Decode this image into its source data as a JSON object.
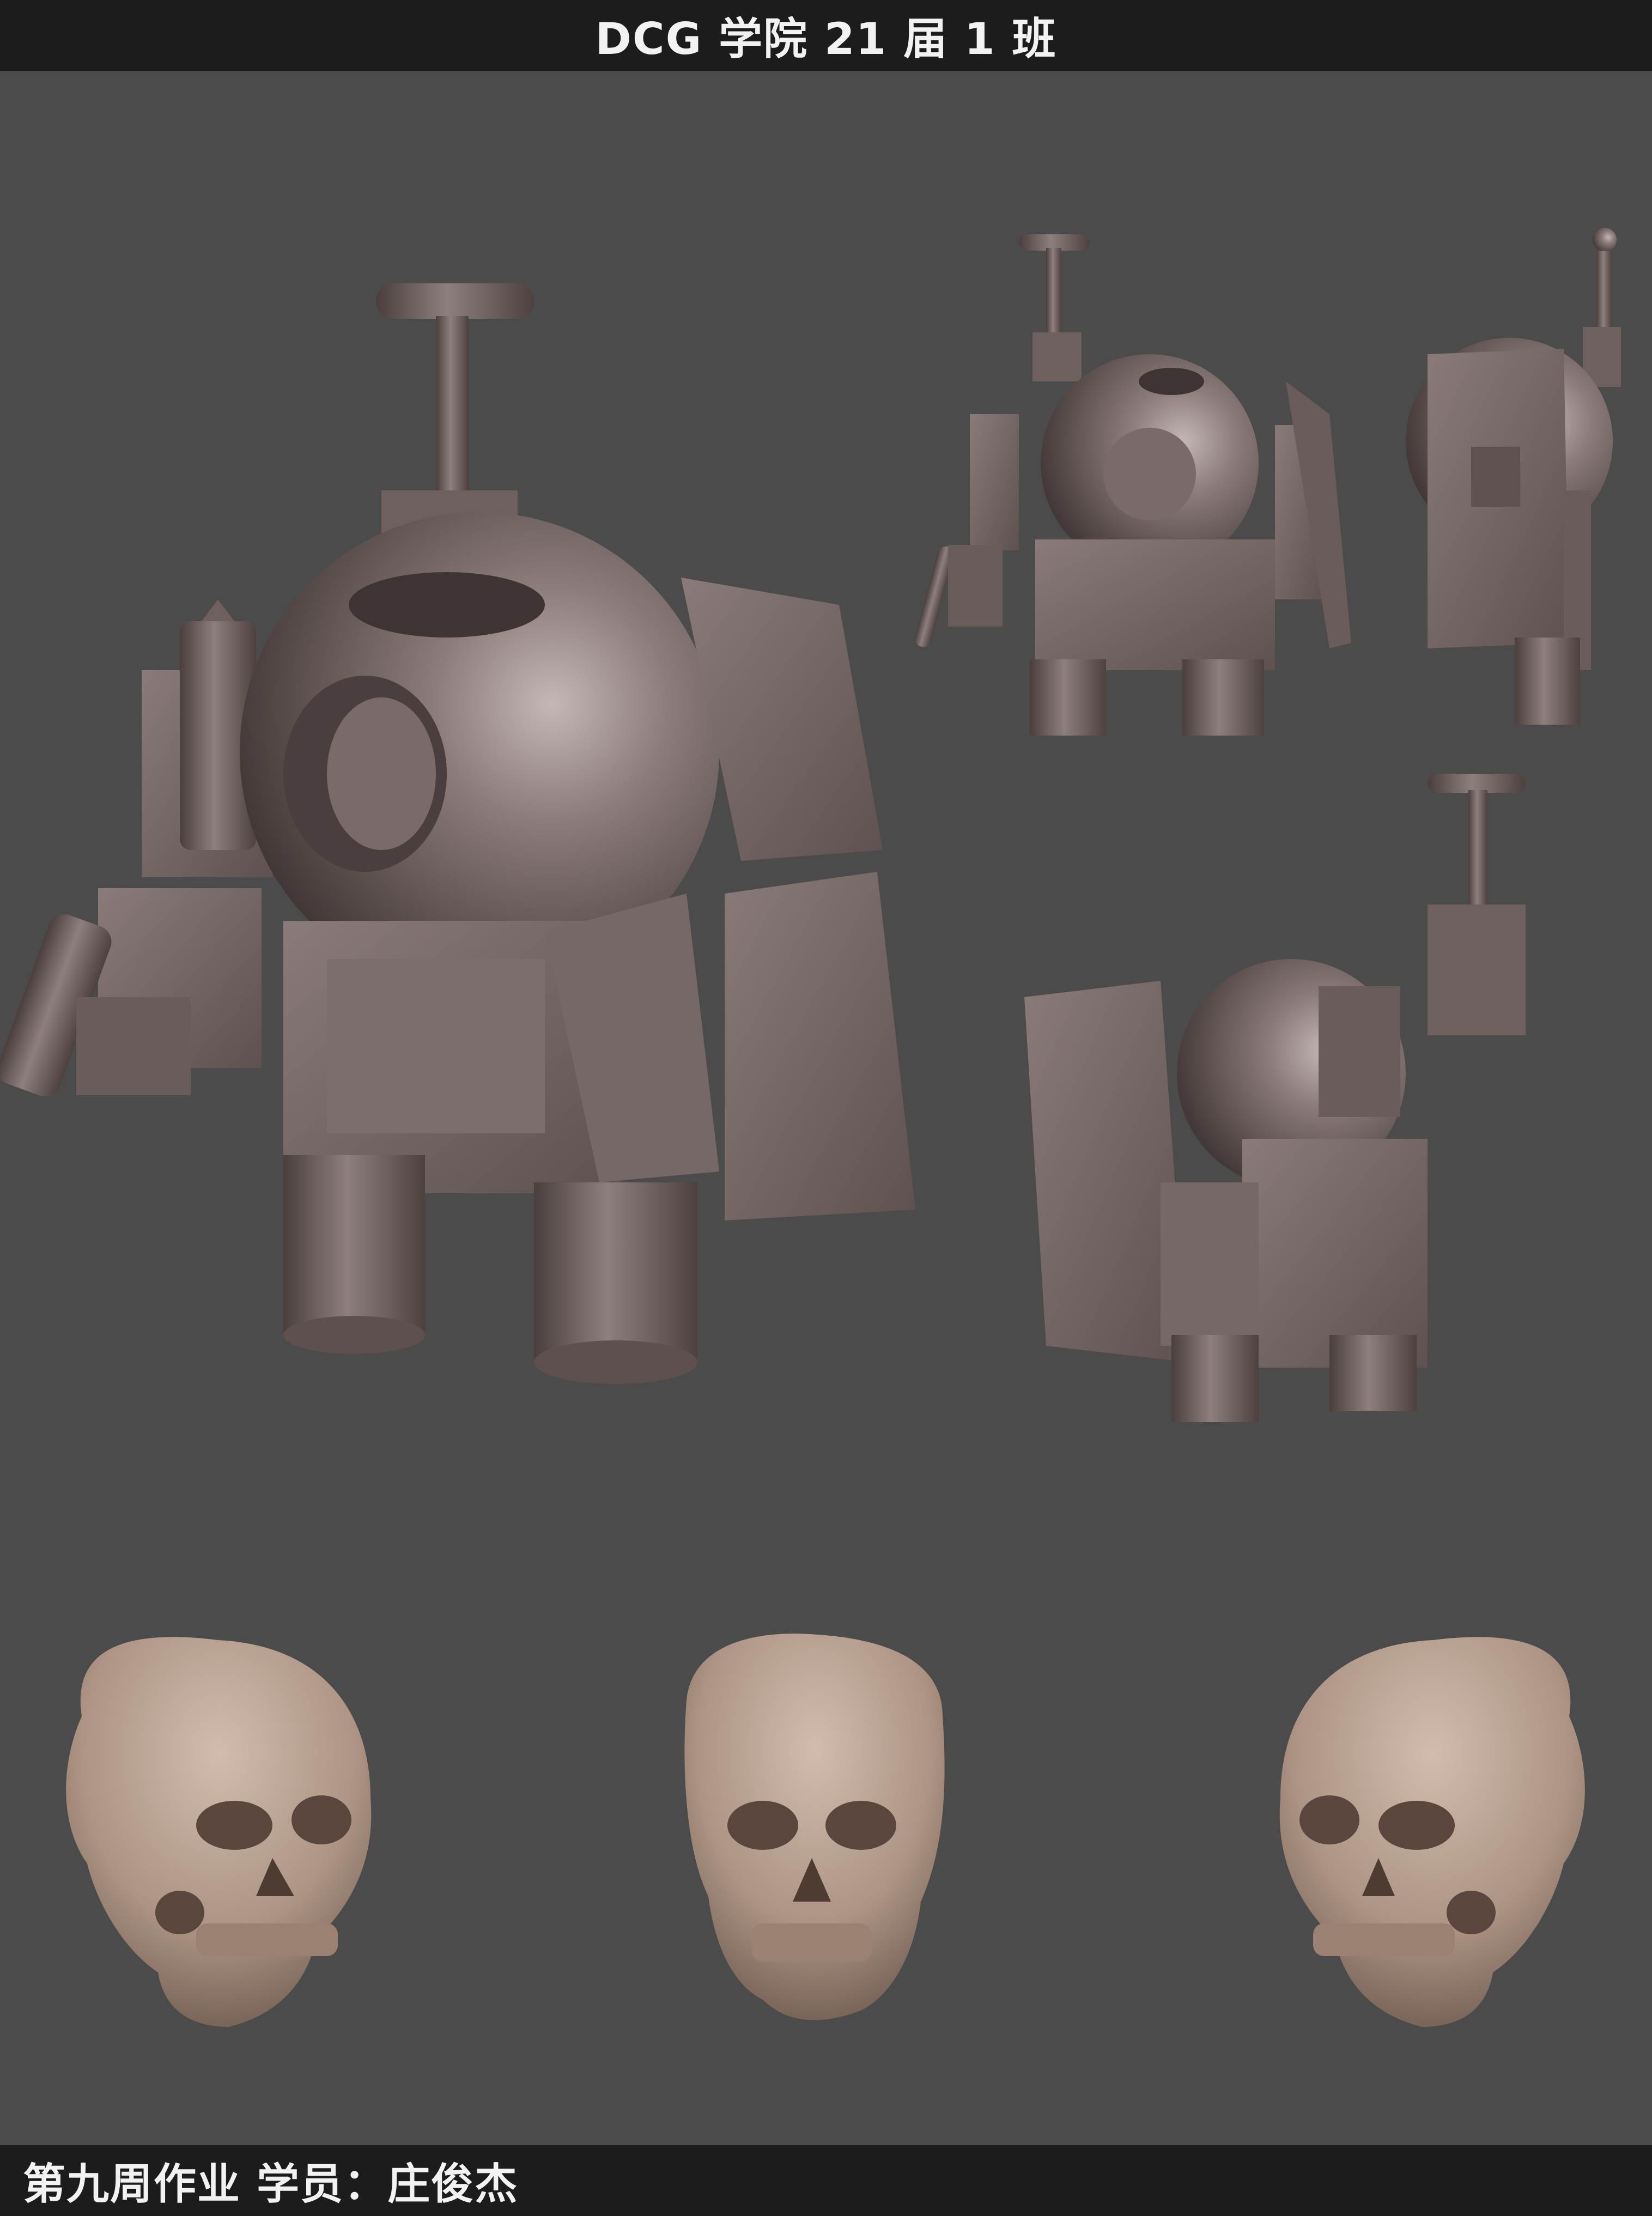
{
  "header": {
    "title": "DCG 学院 21 届 1 班"
  },
  "footer": {
    "caption": "第九周作业  学员：庄俊杰"
  },
  "colors": {
    "background": "#4b4b4b",
    "bar": "#1c1c1c",
    "robot": "#7d6f6e",
    "skull": "#b0988a"
  },
  "artwork": {
    "robot_views": [
      "robot-main-3q-view",
      "robot-front-view",
      "robot-side-view",
      "robot-back-view"
    ],
    "skull_views": [
      "skull-left-3q-view",
      "skull-front-view",
      "skull-right-3q-view"
    ]
  }
}
